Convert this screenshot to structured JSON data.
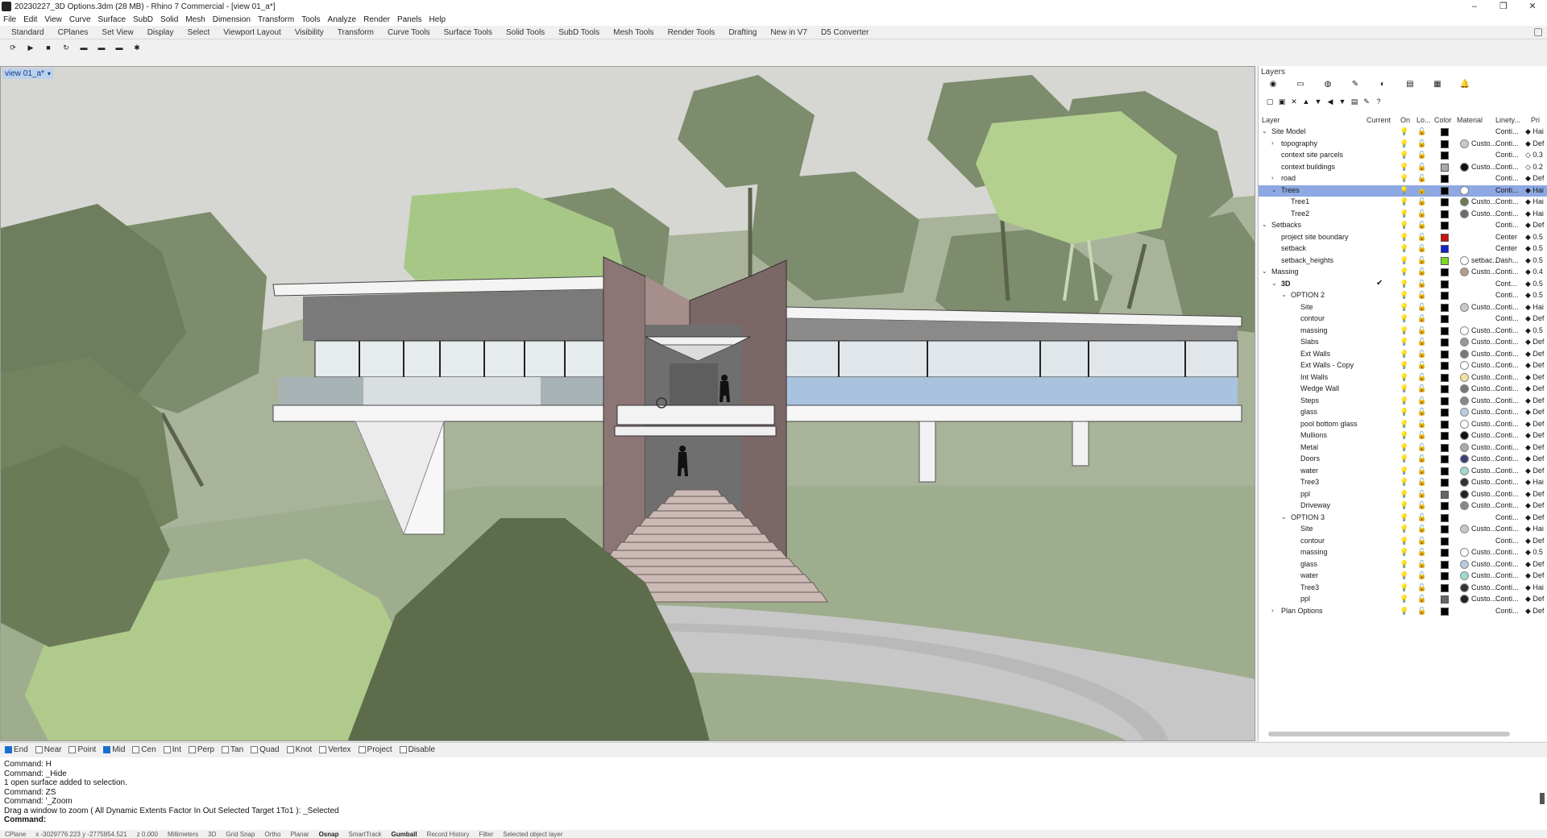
{
  "window": {
    "title": "20230227_3D Options.3dm (28 MB) - Rhino 7 Commercial - [view 01_a*]",
    "controls": [
      "–",
      "❐",
      "✕"
    ]
  },
  "menu": [
    "File",
    "Edit",
    "View",
    "Curve",
    "Surface",
    "SubD",
    "Solid",
    "Mesh",
    "Dimension",
    "Transform",
    "Tools",
    "Analyze",
    "Render",
    "Panels",
    "Help"
  ],
  "tabs": [
    "Standard",
    "CPlanes",
    "Set View",
    "Display",
    "Select",
    "Viewport Layout",
    "Visibility",
    "Transform",
    "Curve Tools",
    "Surface Tools",
    "Solid Tools",
    "SubD Tools",
    "Mesh Tools",
    "Render Tools",
    "Drafting",
    "New in V7",
    "D5 Converter"
  ],
  "toolbar_icons": [
    "record-icon",
    "play-icon",
    "stop-icon",
    "loop-icon",
    "camera-icon",
    "camera-add-icon",
    "camera-export-icon",
    "settings-icon"
  ],
  "toolbar_glyphs": [
    "⟳",
    "▶",
    "■",
    "↻",
    "▬",
    "▬",
    "▬",
    "✱"
  ],
  "viewport": {
    "label": "view 01_a*",
    "dropdown": "▾"
  },
  "layers_panel": {
    "title": "Layers",
    "panel_icons": [
      "◉",
      "▭",
      "◍",
      "✎",
      "◐",
      "▤",
      "▦",
      "🔔"
    ],
    "tool_icons": [
      "▢",
      "▣",
      "✕",
      "▲",
      "▼",
      "◀",
      "▼",
      "▤",
      "✎",
      "?"
    ],
    "columns": {
      "layer": "Layer",
      "current": "Current",
      "on": "On",
      "lock": "Lo...",
      "color": "Color",
      "material": "Material",
      "linetype": "Linety...",
      "print": "Pri"
    },
    "rows": [
      {
        "name": "Site Model",
        "indent": 0,
        "exp": "⌄",
        "on": "y",
        "color": "#000000",
        "mat": "",
        "matname": "",
        "lt": "Conti...",
        "pw": "◆ Hai",
        "bold": false
      },
      {
        "name": "topography",
        "indent": 1,
        "exp": "›",
        "on": "y",
        "color": "#000000",
        "mat": "#c8c8c8",
        "matname": "Custo...",
        "lt": "Conti...",
        "pw": "◆ Def",
        "bold": false
      },
      {
        "name": "context site parcels",
        "indent": 1,
        "exp": "",
        "on": "y",
        "color": "#000000",
        "mat": "",
        "matname": "",
        "lt": "Conti...",
        "pw": "◇ 0.3",
        "bold": false
      },
      {
        "name": "context buildings",
        "indent": 1,
        "exp": "",
        "on": "y",
        "color": "#aaaaaa",
        "mat": "#111111",
        "matname": "Custo...",
        "lt": "Conti...",
        "pw": "◇ 0.2",
        "bold": false
      },
      {
        "name": "road",
        "indent": 1,
        "exp": "›",
        "on": "y",
        "color": "#000000",
        "mat": "",
        "matname": "",
        "lt": "Conti...",
        "pw": "◆ Def",
        "bold": false
      },
      {
        "name": "Trees",
        "indent": 1,
        "exp": "⌄",
        "on": "y",
        "color": "#000000",
        "mat": "#ffffff",
        "matname": "",
        "lt": "Conti...",
        "pw": "◆ Hai",
        "bold": false,
        "selected": true
      },
      {
        "name": "Tree1",
        "indent": 2,
        "exp": "",
        "on": "y",
        "color": "#000000",
        "mat": "#6b7a55",
        "matname": "Custo...",
        "lt": "Conti...",
        "pw": "◆ Hai",
        "bold": false
      },
      {
        "name": "Tree2",
        "indent": 2,
        "exp": "",
        "on": "y",
        "color": "#000000",
        "mat": "#6b6b6b",
        "matname": "Custo...",
        "lt": "Conti...",
        "pw": "◆ Hai",
        "bold": false
      },
      {
        "name": "Setbacks",
        "indent": 0,
        "exp": "⌄",
        "on": "b",
        "color": "#000000",
        "mat": "",
        "matname": "",
        "lt": "Conti...",
        "pw": "◆ Def",
        "bold": false
      },
      {
        "name": "project site boundary",
        "indent": 1,
        "exp": "",
        "on": "y",
        "color": "#cc1111",
        "mat": "",
        "matname": "",
        "lt": "Center",
        "pw": "◆ 0.5",
        "bold": false
      },
      {
        "name": "setback",
        "indent": 1,
        "exp": "",
        "on": "y",
        "color": "#1122cc",
        "mat": "",
        "matname": "",
        "lt": "Center",
        "pw": "◆ 0.5",
        "bold": false
      },
      {
        "name": "setback_heights",
        "indent": 1,
        "exp": "",
        "on": "b",
        "color": "#77dd22",
        "mat": "#ffffff",
        "matname": "setbac...",
        "lt": "Dash...",
        "pw": "◆ 0.5",
        "bold": false
      },
      {
        "name": "Massing",
        "indent": 0,
        "exp": "⌄",
        "on": "y",
        "color": "#000000",
        "mat": "#b89a8a",
        "matname": "Custo...",
        "lt": "Conti...",
        "pw": "◆ 0.4",
        "bold": false
      },
      {
        "name": "3D",
        "indent": 1,
        "exp": "⌄",
        "on": "y",
        "color": "#000000",
        "mat": "",
        "matname": "",
        "lt": "Cont...",
        "pw": "◆ 0.5",
        "bold": true,
        "current": "✔"
      },
      {
        "name": "OPTION 2",
        "indent": 2,
        "exp": "⌄",
        "on": "y",
        "color": "#000000",
        "mat": "",
        "matname": "",
        "lt": "Conti...",
        "pw": "◆ 0.5",
        "bold": false
      },
      {
        "name": "Site",
        "indent": 3,
        "exp": "",
        "on": "y",
        "color": "#000000",
        "mat": "#c8c8c8",
        "matname": "Custo...",
        "lt": "Conti...",
        "pw": "◆ Hai",
        "bold": false
      },
      {
        "name": "contour",
        "indent": 3,
        "exp": "",
        "on": "b",
        "color": "#000000",
        "mat": "",
        "matname": "",
        "lt": "Conti...",
        "pw": "◆ Def",
        "bold": false
      },
      {
        "name": "massing",
        "indent": 3,
        "exp": "",
        "on": "y",
        "color": "#000000",
        "mat": "#ffffff",
        "matname": "Custo...",
        "lt": "Conti...",
        "pw": "◆ 0.5",
        "bold": false
      },
      {
        "name": "Slabs",
        "indent": 3,
        "exp": "",
        "on": "y",
        "color": "#000000",
        "mat": "#999999",
        "matname": "Custo...",
        "lt": "Conti...",
        "pw": "◆ Def",
        "bold": false
      },
      {
        "name": "Ext Walls",
        "indent": 3,
        "exp": "",
        "on": "y",
        "color": "#000000",
        "mat": "#777777",
        "matname": "Custo...",
        "lt": "Conti...",
        "pw": "◆ Def",
        "bold": false
      },
      {
        "name": "Ext Walls - Copy",
        "indent": 3,
        "exp": "",
        "on": "y",
        "color": "#000000",
        "mat": "#ffffff",
        "matname": "Custo...",
        "lt": "Conti...",
        "pw": "◆ Def",
        "bold": false
      },
      {
        "name": "Int Walls",
        "indent": 3,
        "exp": "",
        "on": "y",
        "color": "#000000",
        "mat": "#f2e2a0",
        "matname": "Custo...",
        "lt": "Conti...",
        "pw": "◆ Def",
        "bold": false
      },
      {
        "name": "Wedge Wall",
        "indent": 3,
        "exp": "",
        "on": "y",
        "color": "#000000",
        "mat": "#777777",
        "matname": "Custo...",
        "lt": "Conti...",
        "pw": "◆ Def",
        "bold": false
      },
      {
        "name": "Steps",
        "indent": 3,
        "exp": "",
        "on": "y",
        "color": "#000000",
        "mat": "#888888",
        "matname": "Custo...",
        "lt": "Conti...",
        "pw": "◆ Def",
        "bold": false
      },
      {
        "name": "glass",
        "indent": 3,
        "exp": "",
        "on": "y",
        "color": "#000000",
        "mat": "#b9cbe0",
        "matname": "Custo...",
        "lt": "Conti...",
        "pw": "◆ Def",
        "bold": false
      },
      {
        "name": "pool bottom glass",
        "indent": 3,
        "exp": "",
        "on": "y",
        "color": "#000000",
        "mat": "#ffffff",
        "matname": "Custo...",
        "lt": "Conti...",
        "pw": "◆ Def",
        "bold": false
      },
      {
        "name": "Mullions",
        "indent": 3,
        "exp": "",
        "on": "y",
        "color": "#000000",
        "mat": "#111111",
        "matname": "Custo...",
        "lt": "Conti...",
        "pw": "◆ Def",
        "bold": false
      },
      {
        "name": "Metal",
        "indent": 3,
        "exp": "",
        "on": "y",
        "color": "#000000",
        "mat": "#aaaaaa",
        "matname": "Custo...",
        "lt": "Conti...",
        "pw": "◆ Def",
        "bold": false
      },
      {
        "name": "Doors",
        "indent": 3,
        "exp": "",
        "on": "y",
        "color": "#000000",
        "mat": "#3a3f77",
        "matname": "Custo...",
        "lt": "Conti...",
        "pw": "◆ Def",
        "bold": false
      },
      {
        "name": "water",
        "indent": 3,
        "exp": "",
        "on": "y",
        "color": "#000000",
        "mat": "#9fd8d0",
        "matname": "Custo...",
        "lt": "Conti...",
        "pw": "◆ Def",
        "bold": false
      },
      {
        "name": "Tree3",
        "indent": 3,
        "exp": "",
        "on": "y",
        "color": "#000000",
        "mat": "#333333",
        "matname": "Custo...",
        "lt": "Conti...",
        "pw": "◆ Hai",
        "bold": false
      },
      {
        "name": "ppl",
        "indent": 3,
        "exp": "",
        "on": "y",
        "color": "#666666",
        "mat": "#222222",
        "matname": "Custo...",
        "lt": "Conti...",
        "pw": "◆ Def",
        "bold": false
      },
      {
        "name": "Driveway",
        "indent": 3,
        "exp": "",
        "on": "y",
        "color": "#000000",
        "mat": "#888888",
        "matname": "Custo...",
        "lt": "Conti...",
        "pw": "◆ Def",
        "bold": false
      },
      {
        "name": "OPTION 3",
        "indent": 2,
        "exp": "⌄",
        "on": "b",
        "color": "#000000",
        "mat": "",
        "matname": "",
        "lt": "Conti...",
        "pw": "◆ Def",
        "bold": false
      },
      {
        "name": "Site",
        "indent": 3,
        "exp": "",
        "on": "b",
        "color": "#000000",
        "mat": "#c8c8c8",
        "matname": "Custo...",
        "lt": "Conti...",
        "pw": "◆ Hai",
        "bold": false
      },
      {
        "name": "contour",
        "indent": 3,
        "exp": "",
        "on": "b",
        "color": "#000000",
        "mat": "",
        "matname": "",
        "lt": "Conti...",
        "pw": "◆ Def",
        "bold": false
      },
      {
        "name": "massing",
        "indent": 3,
        "exp": "",
        "on": "b",
        "color": "#000000",
        "mat": "#ffffff",
        "matname": "Custo...",
        "lt": "Conti...",
        "pw": "◆ 0.5",
        "bold": false
      },
      {
        "name": "glass",
        "indent": 3,
        "exp": "",
        "on": "b",
        "color": "#000000",
        "mat": "#b9cbe0",
        "matname": "Custo...",
        "lt": "Conti...",
        "pw": "◆ Def",
        "bold": false
      },
      {
        "name": "water",
        "indent": 3,
        "exp": "",
        "on": "b",
        "color": "#000000",
        "mat": "#9fd8d0",
        "matname": "Custo...",
        "lt": "Conti...",
        "pw": "◆ Def",
        "bold": false
      },
      {
        "name": "Tree3",
        "indent": 3,
        "exp": "",
        "on": "b",
        "color": "#000000",
        "mat": "#333333",
        "matname": "Custo...",
        "lt": "Conti...",
        "pw": "◆ Hai",
        "bold": false
      },
      {
        "name": "ppl",
        "indent": 3,
        "exp": "",
        "on": "b",
        "color": "#666666",
        "mat": "#222222",
        "matname": "Custo...",
        "lt": "Conti...",
        "pw": "◆ Def",
        "bold": false
      },
      {
        "name": "Plan Options",
        "indent": 1,
        "exp": "›",
        "on": "b",
        "color": "#000000",
        "mat": "",
        "matname": "",
        "lt": "Conti...",
        "pw": "◆ Def",
        "bold": false
      }
    ]
  },
  "osnap": [
    {
      "label": "End",
      "on": true
    },
    {
      "label": "Near",
      "on": false
    },
    {
      "label": "Point",
      "on": false
    },
    {
      "label": "Mid",
      "on": true
    },
    {
      "label": "Cen",
      "on": false
    },
    {
      "label": "Int",
      "on": false
    },
    {
      "label": "Perp",
      "on": false
    },
    {
      "label": "Tan",
      "on": false
    },
    {
      "label": "Quad",
      "on": false
    },
    {
      "label": "Knot",
      "on": false
    },
    {
      "label": "Vertex",
      "on": false
    },
    {
      "label": "Project",
      "on": false
    },
    {
      "label": "Disable",
      "on": false
    }
  ],
  "command": {
    "history": [
      "Command: H",
      "Command: _Hide",
      "1 open surface added to selection.",
      "Command: ZS",
      "Command: '_Zoom",
      "Drag a window to zoom ( All  Dynamic  Extents  Factor  In  Out  Selected  Target  1To1 ): _Selected"
    ],
    "prompt": "Command:"
  },
  "status": {
    "cplane": "CPlane",
    "coords": "x -3029776.223  y -2775854.521",
    "z": "z 0.000",
    "units": "Millimeters",
    "layer": "3D",
    "toggles": [
      "Grid Snap",
      "Ortho",
      "Planar",
      "Osnap",
      "SmartTrack",
      "Gumball",
      "Record History",
      "Filter",
      "Selected object layer"
    ],
    "active": [
      "Osnap",
      "Gumball"
    ]
  }
}
